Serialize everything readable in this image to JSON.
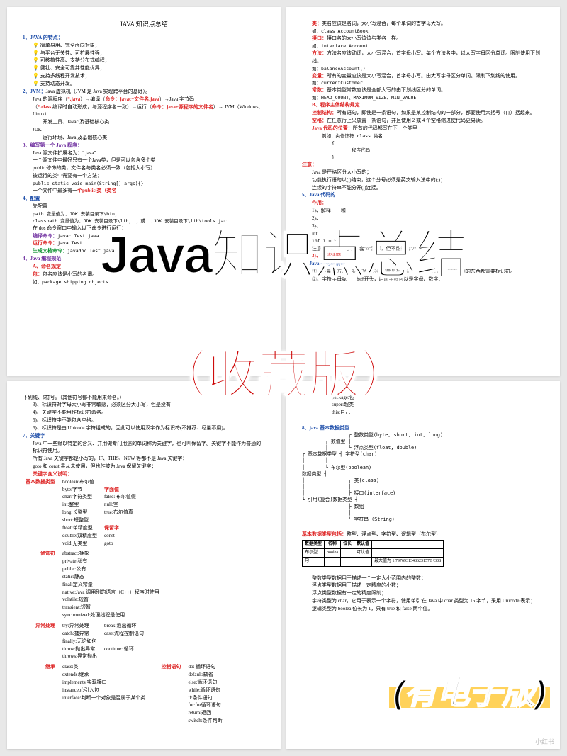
{
  "overlay": {
    "title": "Java知识点总结",
    "subtitle": "（收藏版）",
    "footer": "(有电子版)"
  },
  "watermark": "小红书",
  "page1": {
    "heading": "JAVA 知识点总结",
    "s1_title": "1、JAVA 的特点：",
    "s1_items": [
      "简单易用、完全面向对象；",
      "与平台无关性、可扩展性强；",
      "可移植性高、支持分布式编程；",
      "健壮、安全可靠并性能优异；",
      "支持多线程开发技术；",
      "支持动态开发。"
    ],
    "s2_title": "2、JVM：",
    "s2_l1": "Java 虚拟机（JVM 是 Java 实现跨平台的基础）。",
    "s2_l2a": "Java 的源程序（",
    "s2_l2b": "*.java",
    "s2_l2c": "）→编译（",
    "s2_l2d": "命令：javac+文件名.java",
    "s2_l2e": "）→Java 字节码",
    "s2_l3a": "（",
    "s2_l3b": "*.class",
    "s2_l3c": " 编译时自动形成，与源程序名一致）→运行（",
    "s2_l3d": "命令：java+源程序的文件名",
    "s2_l3e": "）→ JVM（Windows、Linux）",
    "s2_l4": "开发工具、Javac 及基础核心类",
    "s2_l5": "JDK",
    "s2_l6": "运行环境、Java 及基础核心类",
    "s3_title": "3、编写第一个 Java 程序：",
    "s3_lines": [
      "Java 源文件扩展名为：\".java\"",
      "一个源文件中最好只有一个Java类，但是可以包含多个类",
      "public 修饰的类，文件名与类名必须一致（包括大小写）",
      "被运行的类中需要有一个方法："
    ],
    "s3_code": "public static void main(String[] args){}",
    "s3_l5a": "一个文件中最多有一",
    "s3_l5b": "个public 类（类名",
    "cfg_t": "4、配置",
    "cfg_l1": "先配置",
    "cfg_l2": "path 变量值为：JDK 安装目录下\\bin；",
    "cfg_l3": "classpath 变量值为：JDK 安装目录下\\lib；.；或 .;JDK 安装目录下\\lib\\tools.jar",
    "cfg_l4": "在 dos 命令窗口中输入以下命令进行运行：",
    "cfg_cmd1_lbl": "编译命令：",
    "cfg_cmd1": "javac Test.java",
    "cfg_cmd2_lbl": "运行命令：",
    "cfg_cmd2": "java Test",
    "cfg_cmd3_lbl": "生成文档命令：",
    "cfg_cmd3": "javadoc Test.java",
    "naming_t": "4、Java 编程规范",
    "naming_a": "A、命名规定",
    "naming_pkg_lbl": "包：",
    "naming_pkg": "包名应该是小写的名词。",
    "naming_pkg_eg": "如：package  shipping.objects"
  },
  "page2": {
    "cls_lbl": "类：",
    "cls": "类名应该是名词，大小写混合，每个单词的首字母大写。",
    "cls_eg": "如：class AccountBook",
    "if_lbl": "接口：",
    "if": "接口名的大小写该该与类名一样。",
    "if_eg": "如：interface Account",
    "m_lbl": "方法：",
    "m": "方法名应该动词，大小写混合，首字母小写。每个方法名中，以大写字母区分单词。限制使用下划线。",
    "m_eg": "如：balanceAccount()",
    "v_lbl": "变量：",
    "v": "所有的变量应该是大小写混合，首字母小写。由大写字母区分单词。限制下划线的使用。",
    "v_eg": "如：currentCustomer",
    "c_lbl": "常数：",
    "c": "基本类型常数应该是全部大写的由下划线区分的单词。",
    "c_eg": "如：HEAD_COUNT、MAXIMUM_SIZE、MIN_VALUE",
    "b_t": "B、程序主体结构规定",
    "ctrl_lbl": "控制结构：",
    "ctrl": "所有语句，即使是一条语句，如果是某控制结构的一部分，都要使用大括号（{}）括起来。",
    "sp_lbl": "空格：",
    "sp": "在任意行上只放置一条语句，并且使用 2 或 4 个空格缩进使代码更易读。",
    "pos_lbl": "Java 代码的位置：",
    "pos": "所有的代码都写在下一个类里",
    "pos_eg1": "例如：类修饰符 class 类名",
    "pos_eg2": "{",
    "pos_eg3": "程序代码",
    "pos_eg4": "}",
    "note_t": "注意：",
    "note_1": "Java 是严格区分大小写的；",
    "note_2": "功能执行语句以(;)结束，这个分号必须是英文输入法中的(;)；",
    "note_3": "连续的字符串不能分开(;)连接。",
    "s5_t": "5、Java 代码的",
    "s5_use": "作用：",
    "s5_1": "1)、解释",
    "s5_1b": "和",
    "s5_2": "2)、",
    "s5_3": "3)、",
    "s5_intlbl": "int",
    "s5_int": "int i = 5;",
    "s5_note": "注意：/*…*/中可以嵌套\"//\"注释，但不能嵌套\"/*…*/\"。",
    "s5_doc": "3)、文档注释",
    "s6_t": "6、Java 中的标识符",
    "s6_1": "①、变量、方法、类和对象的名称都是标识符，程序员需要标识和使用的东西都需要标识符。",
    "s6_2a": "②、",
    "s6_2b": "$符开头，后面字符可以是字母、数字、",
    "s6_2c": "字符字母或",
    "s6_ul": "下划线、$符号。（其他符号都不能用来命名。）",
    "s6_3": "3)、标识符对字母大小写非常敏感，必须区分大小写，但是没有",
    "s6_4": "4)、关键字不能用作标识符命名。",
    "s6_5": "5)、标识符中不能包含空格。",
    "s6_6": "6)、标识符是由 Unicode 字符组成的，因此可以使用汉字作为标识符(不推荐、尽量不用)。"
  },
  "page3": {
    "s7_t": "7、关键字",
    "s7_1": "Java 中一些赋以特定的含义、并用做专门用途的单词称为关键字，也可叫保留字。关键字不能作为普通的标识符使用。",
    "s7_2": "所有 Java 关键字都是小写的，IF、THIS、NEW 等都不是 Java 关键字；",
    "s7_3": "goto 和 const 虽从未使用，但也作被为 Java 保留关键字；",
    "kw_t": "关键字含义说明：",
    "g1_lbl": "基本数据类型",
    "g1_items": [
      "boolean:布尔值",
      "byte:字节",
      "char:字符类型",
      "int:整型",
      "long:长整型",
      "short:短整型",
      "float:单精度型",
      "double:双精度型",
      "void:无类型"
    ],
    "lit_lbl": "字面值",
    "lit_items": [
      "false: 布尔值假",
      "null:空",
      "true:布尔值真"
    ],
    "res_lbl": "保留字",
    "res_items": [
      "const",
      "goto"
    ],
    "g2_lbl": "修饰符",
    "g2_items": [
      "abstract:抽象",
      "private:私有",
      "public:公有",
      "static:静态",
      "final:定义常量",
      "native:Java 调用别的语言（C++）程序时使用",
      "volatile:短暂",
      "transient:短暂",
      "synchronized:处理线程是使用"
    ],
    "g3_lbl": "异常处理",
    "g3_items": [
      "try:异常处理",
      "catch:捕异常",
      "finally:无论如何",
      "throw:抛出异常",
      "throws:异常抛出"
    ],
    "g3b_items": [
      "break:退出循环",
      "case:流程控制语句",
      "continue: 循环"
    ],
    "g4_lbl": "继承",
    "g4_items": [
      "class:类",
      "extends:继承",
      "implements:实现接口",
      "instanceof:引入包",
      "interface:判断一个对象是否属于某个类"
    ],
    "g5_lbl": "控制语句",
    "g5_items": [
      "do: 循环语句",
      "default:缺省",
      "else:循环语句",
      "while:循环语句",
      "if:条件语句",
      "for:for循环语句",
      "return:返回",
      "switch:条件判断"
    ],
    "pkg_items": [
      "package:包",
      "super:超类",
      "this:自己"
    ]
  },
  "page4": {
    "s8_t": "8、java 基本数据类型",
    "tree": "                ┌ 整数类型(byte, short, int, long)\n        ┌ 数值型 ┤\n        │       └ 浮点类型(float, double)\n┌ 基本数据类型 ┤ 字符型(char)\n│       │\n│       └ 布尔型(boolean)\n数据类型 ┤\n│               ┌ 类(class)\n│               │\n│               ├ 接口(interface)\n└ 引用(复合)数据类型 ┤\n                ├ 数组\n                │\n                └ 字符串 (String)",
    "tbl_t": "基本数据类型包括：",
    "tbl_t2": "整型、浮点型、字符型、逻辑型（布尔型）",
    "th": [
      "数据类型",
      "名称",
      "位长",
      "默认值"
    ],
    "r1": [
      "布尔型",
      "boolea",
      "",
      "可认值"
    ],
    "r2": [
      "句",
      "",
      "",
      ""
    ],
    "notes": [
      "整数类型数据用于描述一个一定大小范围内的整数；",
      "浮点类型数据用于描述一定精度的小数；",
      "浮点类型数据有一定的精度限制；",
      "字符类型为 char，它用于表示一个字符，使用单引'在 Java 中 char 类型为 16 字节，采用 Unicode 表示；",
      "逻辑类型为 boolea 位长为 1，只有 true 和 false 两个值。"
    ],
    "maxval": "最大值为 1.7976931348623157E+308"
  }
}
